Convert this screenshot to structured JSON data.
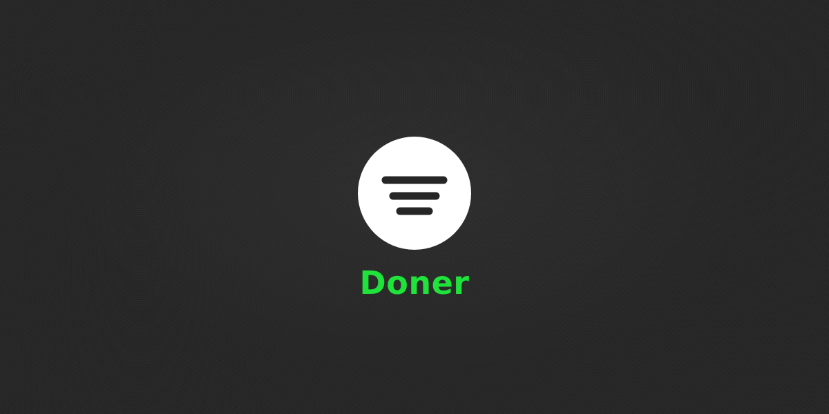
{
  "brand": {
    "name": "Doner",
    "name_color": "#1fe33a",
    "icon": "doner-logo-icon",
    "icon_background": "#ffffff",
    "icon_lines_color": "#262626"
  },
  "background": {
    "color": "#262626"
  }
}
